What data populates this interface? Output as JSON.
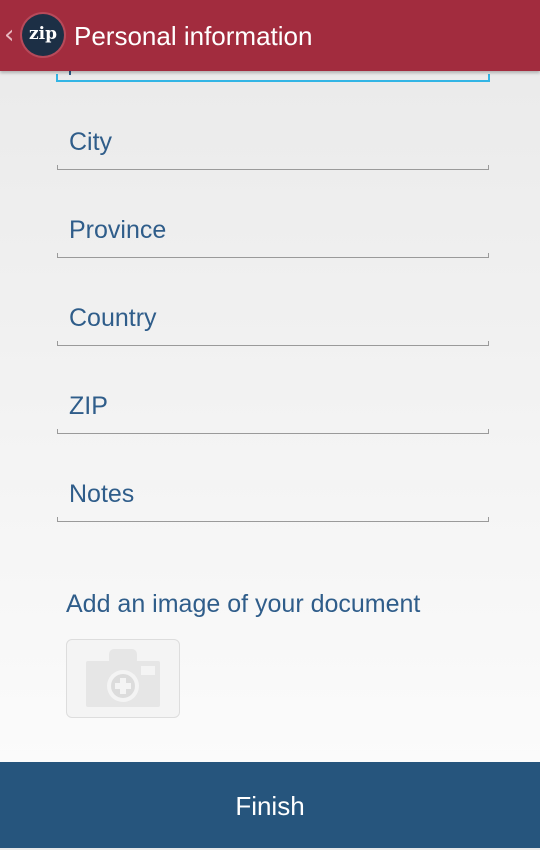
{
  "app_bar": {
    "title": "Personal information",
    "logo_text": "zip",
    "back_icon": "chevron-left-icon",
    "color": "#a22c3e"
  },
  "form": {
    "fields": [
      {
        "key": "city",
        "placeholder": "City"
      },
      {
        "key": "province",
        "placeholder": "Province"
      },
      {
        "key": "country",
        "placeholder": "Country"
      },
      {
        "key": "zip",
        "placeholder": "ZIP"
      },
      {
        "key": "notes",
        "placeholder": "Notes"
      }
    ],
    "focused_field_color": "#33b5e5",
    "label_color": "#2f5d8a"
  },
  "document": {
    "label": "Add an image of your document",
    "add_photo_icon": "camera-add-icon"
  },
  "footer": {
    "finish_label": "Finish",
    "color": "#26557d"
  }
}
